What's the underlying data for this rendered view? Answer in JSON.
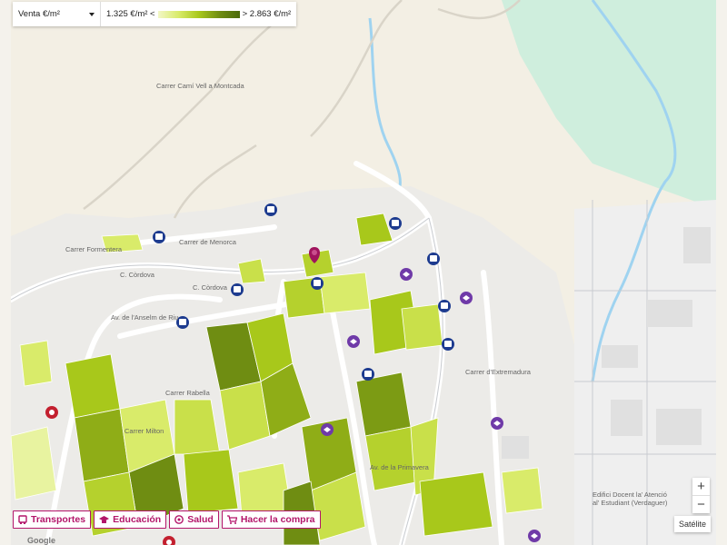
{
  "controls": {
    "operation_select": {
      "value": "Venta €/m²"
    },
    "price_legend": {
      "min": "1.325 €/m² <",
      "max": "> 2.863 €/m²"
    },
    "zoom_in": "+",
    "zoom_out": "−",
    "map_type_button": "Satélite"
  },
  "categories": [
    {
      "label": "Transportes",
      "icon": "bus-icon"
    },
    {
      "label": "Educación",
      "icon": "graduation-cap-icon"
    },
    {
      "label": "Salud",
      "icon": "health-cross-icon"
    },
    {
      "label": "Hacer la compra",
      "icon": "shopping-cart-icon"
    }
  ],
  "map_labels": {
    "building_label": "Edifici Docent la' Atenció al' Estudiant (Verdaguer)",
    "attribution": "Google"
  },
  "colors": {
    "accent": "#b3156a",
    "transport": "#1d3b8f",
    "education": "#6f3aa8",
    "health": "#c3202f",
    "gradient_low": "#f2f7c6",
    "gradient_high": "#4b6a0c"
  }
}
